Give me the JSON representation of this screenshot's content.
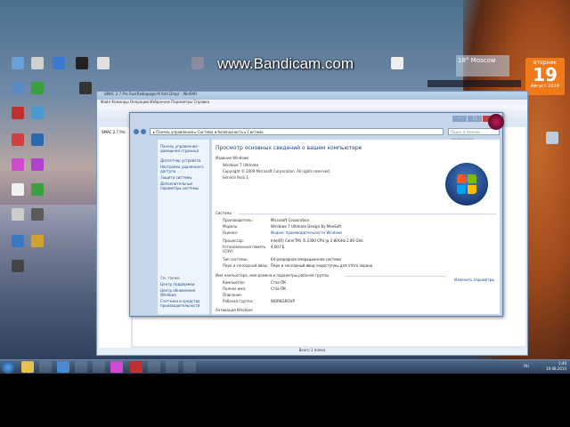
{
  "watermark": "www.Bandicam.com",
  "calendar": {
    "weekday": "вторник",
    "day": "19",
    "month": "Август 2014"
  },
  "weather": {
    "temp": "18°",
    "city": "Moscow"
  },
  "backwindow": {
    "title": "SMAC 2.7 Pro Rus(Radiopage:M Anti Drop) - WinRAR",
    "menu": "Файл  Команды  Операции  Избранное  Параметры  Справка",
    "left_item": "SMAC 2.7 Pro",
    "status": "Всего 1 папка"
  },
  "syswin": {
    "address": "▸ Панель управления ▸ Система и безопасность ▸ Система",
    "search_placeholder": "Поиск в панели управления",
    "left_links": [
      "Панель управления - домашняя страница",
      "Диспетчер устройств",
      "Настройка удаленного доступа",
      "Защита системы",
      "Дополнительные параметры системы"
    ],
    "see_also": "См. также",
    "see_also_links": [
      "Центр поддержки",
      "Центр обновления Windows",
      "Счетчики и средства производительности"
    ],
    "heading": "Просмотр основных сведений о вашем компьютере",
    "edition_header": "Издание Windows",
    "edition": "Windows 7 Ultimate",
    "copyright": "Copyright © 2009 Microsoft Corporation. All rights reserved.",
    "service_pack": "Service Pack 1",
    "system_header": "Система",
    "rows": [
      {
        "label": "Производитель:",
        "value": "Microsoft Corporation"
      },
      {
        "label": "Модель:",
        "value": "Windows 7 Ultimate Design By MeeSoft"
      },
      {
        "label": "Оценка:",
        "value": "Индекс производительности Windows"
      },
      {
        "label": "Процессор:",
        "value": "Intel(R) Core(TM) i5-2300 CPU @ 2.80GHz  2.80 GHz"
      },
      {
        "label": "Установленная память (ОЗУ):",
        "value": "4,00 ГБ"
      },
      {
        "label": "Тип системы:",
        "value": "64-разрядная операционная система"
      },
      {
        "label": "Перо и сенсорный ввод:",
        "value": "Перо и сенсорный ввод недоступны для этого экрана"
      }
    ],
    "name_header": "Имя компьютера, имя домена и параметры рабочей группы",
    "change_link": "Изменить параметры",
    "name_rows": [
      {
        "label": "Компьютер:",
        "value": "Стас-ПК"
      },
      {
        "label": "Полное имя:",
        "value": "Стас-ПК"
      },
      {
        "label": "Описание:",
        "value": ""
      },
      {
        "label": "Рабочая группа:",
        "value": "WORKGROUP"
      }
    ],
    "activation_header": "Активация Windows"
  },
  "tray": {
    "time": "1:40",
    "date": "19.08.2014",
    "lang": "RU"
  }
}
